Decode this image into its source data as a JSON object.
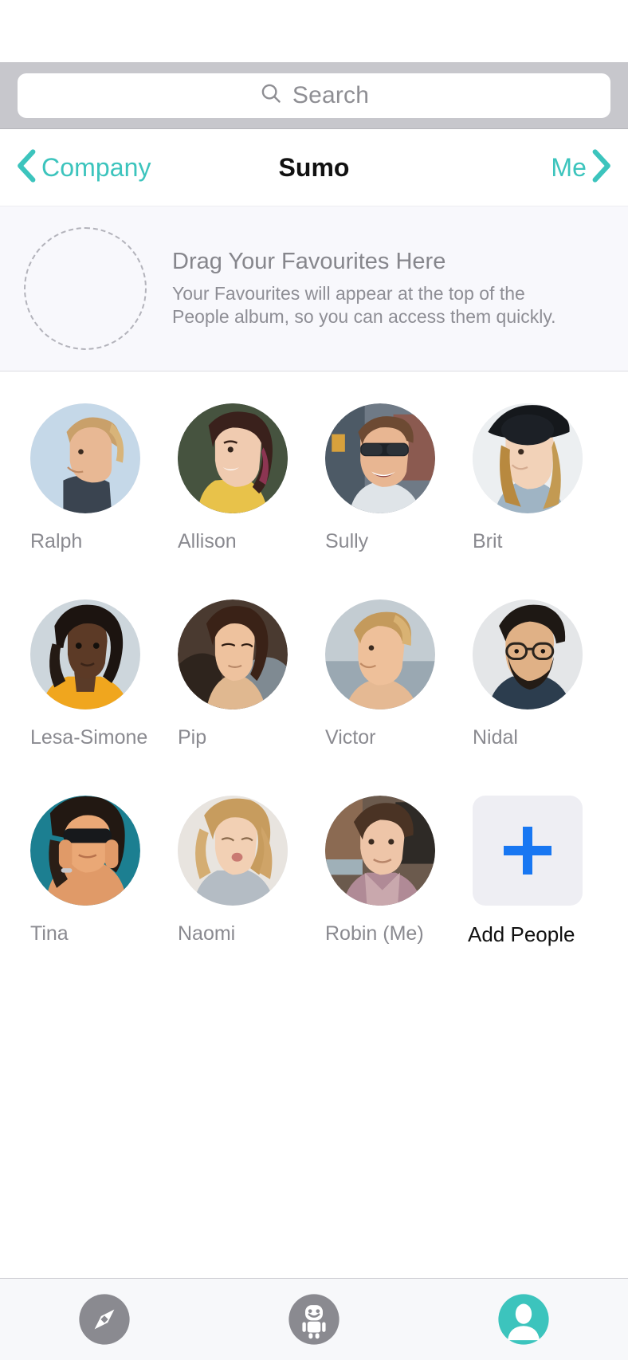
{
  "search": {
    "placeholder": "Search",
    "icon": "search-icon"
  },
  "navbar": {
    "back_label": "Company",
    "back_icon": "chevron-left-icon",
    "title": "Sumo",
    "forward_label": "Me",
    "forward_icon": "chevron-right-icon"
  },
  "favourites_banner": {
    "title": "Drag Your Favourites Here",
    "description_line1": "Your Favourites will appear at the top of the",
    "description_line2": "People album, so you can access them quickly.",
    "dropzone_icon": "dashed-circle-placeholder"
  },
  "people": [
    {
      "name": "Ralph"
    },
    {
      "name": "Allison"
    },
    {
      "name": "Sully"
    },
    {
      "name": "Brit"
    },
    {
      "name": "Lesa-Simone"
    },
    {
      "name": "Pip"
    },
    {
      "name": "Victor"
    },
    {
      "name": "Nidal"
    },
    {
      "name": "Tina"
    },
    {
      "name": "Naomi"
    },
    {
      "name": "Robin  (Me)"
    }
  ],
  "add_people": {
    "label": "Add People",
    "icon": "plus-icon",
    "accent": "#1877f2"
  },
  "tabbar": {
    "tabs": [
      {
        "name": "discover",
        "icon": "compass-icon",
        "active": false
      },
      {
        "name": "bot",
        "icon": "robot-icon",
        "active": false
      },
      {
        "name": "profile",
        "icon": "person-icon",
        "active": true
      }
    ]
  },
  "colors": {
    "accent_teal": "#3cc4bd",
    "inactive_grey": "#8a8a90",
    "search_bar_bg": "#c7c7cc",
    "banner_bg": "#f8f8fc",
    "add_blue": "#1877f2"
  }
}
